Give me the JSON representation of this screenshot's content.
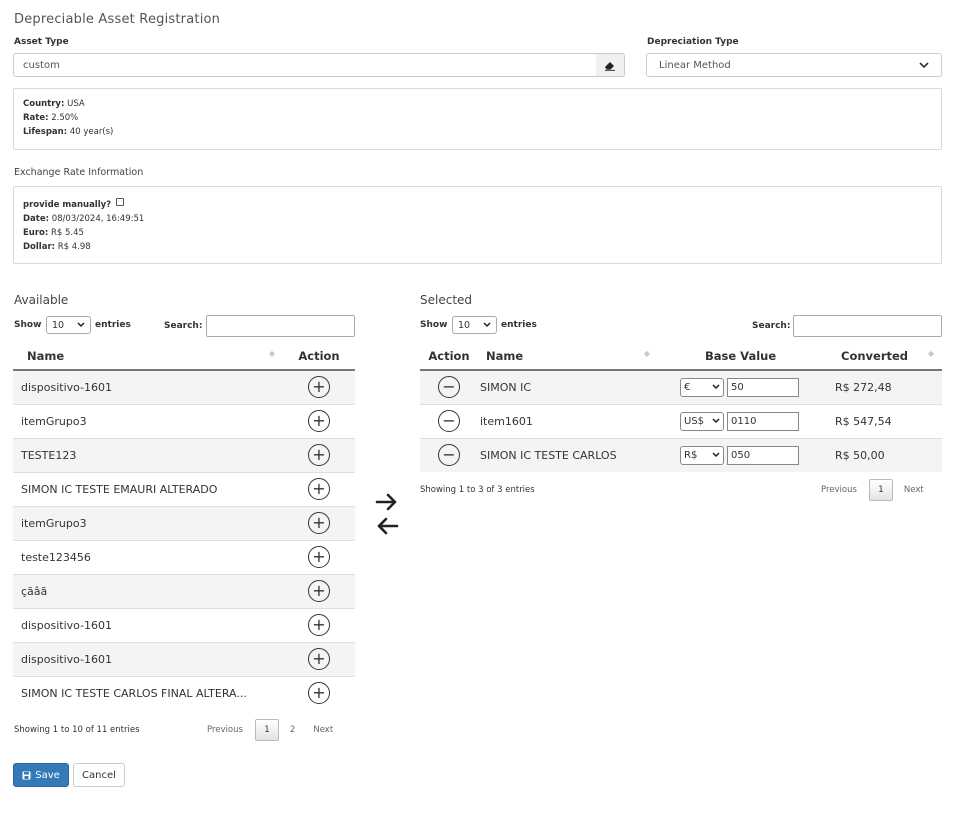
{
  "page_title": "Depreciable Asset Registration",
  "asset_type": {
    "label": "Asset Type",
    "value": "custom"
  },
  "depreciation_type": {
    "label": "Depreciation Type",
    "value": "Linear Method"
  },
  "asset_info": {
    "country_label": "Country:",
    "country": "USA",
    "rate_label": "Rate:",
    "rate": "2.50%",
    "lifespan_label": "Lifespan:",
    "lifespan": "40 year(s)"
  },
  "exchange": {
    "title": "Exchange Rate Information",
    "manual_label": "provide manually?",
    "date_label": "Date:",
    "date": "08/03/2024, 16:49:51",
    "euro_label": "Euro:",
    "euro": "R$ 5.45",
    "dollar_label": "Dollar:",
    "dollar": "R$ 4.98"
  },
  "available": {
    "title": "Available",
    "show_label": "Show",
    "entries_value": "10",
    "entries_label": "entries",
    "search_label": "Search:",
    "col_name": "Name",
    "col_action": "Action",
    "rows": [
      {
        "name": "dispositivo-1601"
      },
      {
        "name": "itemGrupo3"
      },
      {
        "name": "TESTE123"
      },
      {
        "name": "SIMON IC TESTE EMAURI ALTERADO"
      },
      {
        "name": "itemGrupo3"
      },
      {
        "name": "teste123456"
      },
      {
        "name": "çãâã"
      },
      {
        "name": "dispositivo-1601"
      },
      {
        "name": "dispositivo-1601"
      },
      {
        "name": "SIMON IC TESTE CARLOS FINAL ALTERA..."
      }
    ],
    "info": "Showing 1 to 10 of 11 entries",
    "pager": {
      "previous": "Previous",
      "page1": "1",
      "page2": "2",
      "next": "Next"
    }
  },
  "selected": {
    "title": "Selected",
    "show_label": "Show",
    "entries_value": "10",
    "entries_label": "entries",
    "search_label": "Search:",
    "col_action": "Action",
    "col_name": "Name",
    "col_base": "Base Value",
    "col_converted": "Converted",
    "rows": [
      {
        "name": "SIMON IC",
        "currency": "€",
        "base": "50",
        "converted": "R$ 272,48"
      },
      {
        "name": "item1601",
        "currency": "US$",
        "base": "0110",
        "converted": "R$ 547,54"
      },
      {
        "name": "SIMON IC TESTE CARLOS",
        "currency": "R$",
        "base": "050",
        "converted": "R$ 50,00"
      }
    ],
    "info": "Showing 1 to 3 of 3 entries",
    "pager": {
      "previous": "Previous",
      "page1": "1",
      "next": "Next"
    }
  },
  "buttons": {
    "save": "Save",
    "cancel": "Cancel"
  },
  "icons": {
    "eraser": "eraser-icon",
    "chevron": "chevron-down-icon",
    "plus": "plus-circle-icon",
    "minus": "minus-circle-icon",
    "transfer": "transfer-arrows-icon",
    "save": "floppy-icon"
  }
}
